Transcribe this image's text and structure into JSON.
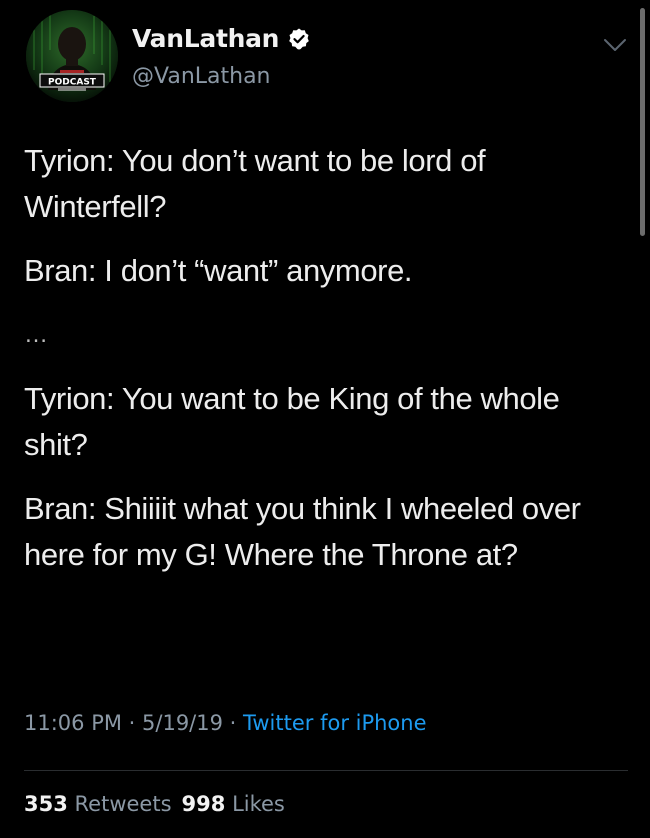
{
  "author": {
    "display_name": "VanLathan",
    "handle": "@VanLathan",
    "verified": true,
    "avatar_banner_text": "PODCAST"
  },
  "tweet": {
    "paragraphs": [
      "Tyrion: You don’t want to be lord of Winterfell?",
      "Bran: I don’t “want” anymore.",
      "…",
      "Tyrion: You want to be King of the whole shit?",
      "Bran: Shiiiit what you think I wheeled over here for my G! Where the Throne at?"
    ]
  },
  "meta": {
    "time": "11:06 PM",
    "separator": " · ",
    "date": "5/19/19",
    "source": "Twitter for iPhone"
  },
  "stats": {
    "retweets_count": "353",
    "retweets_label": "Retweets",
    "likes_count": "998",
    "likes_label": "Likes"
  },
  "colors": {
    "background": "#000000",
    "text": "#ededed",
    "muted": "#8b98a5",
    "link": "#1d9bf0",
    "verified": "#ffffff"
  },
  "icons": {
    "verified": "verified-badge-icon",
    "menu": "chevron-down-icon"
  }
}
